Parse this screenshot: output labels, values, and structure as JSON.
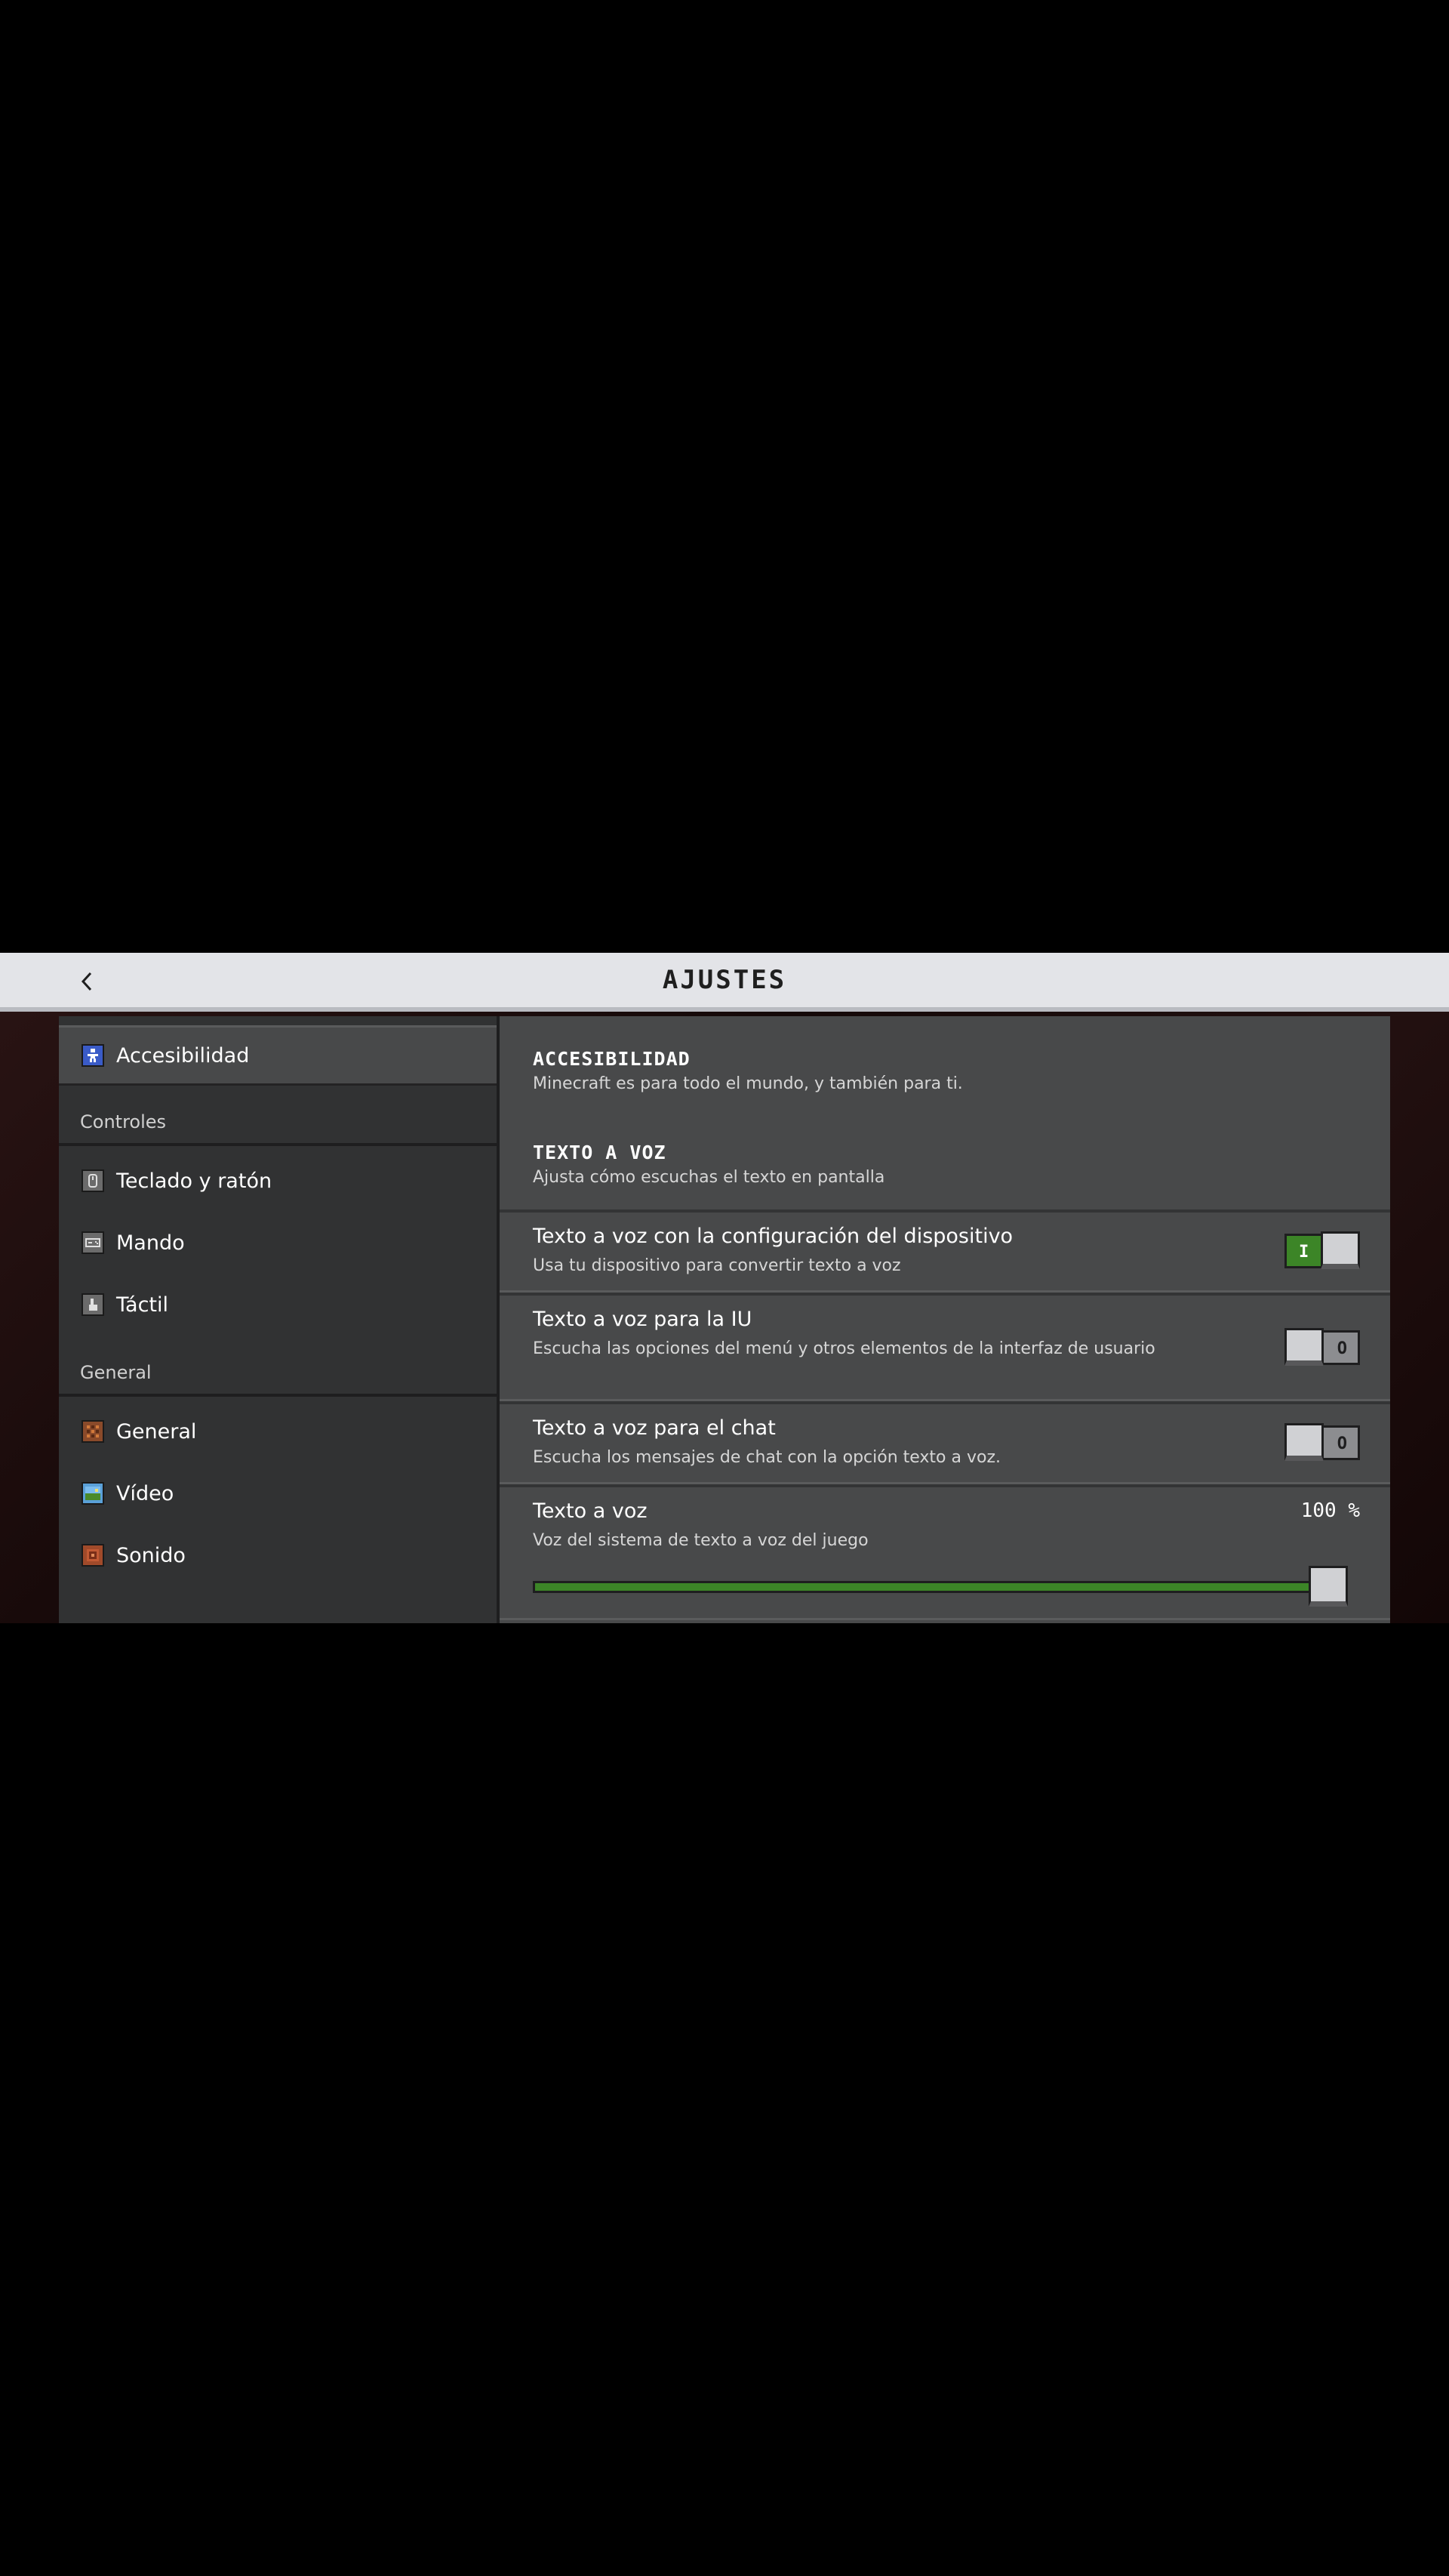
{
  "header": {
    "title": "AJUSTES"
  },
  "sidebar": {
    "active": {
      "label": "Accesibilidad",
      "icon": "accessibility-icon"
    },
    "sections": [
      {
        "label": "Controles",
        "items": [
          {
            "label": "Teclado y ratón",
            "icon": "keyboard-mouse-icon"
          },
          {
            "label": "Mando",
            "icon": "controller-icon"
          },
          {
            "label": "Táctil",
            "icon": "touch-icon"
          }
        ]
      },
      {
        "label": "General",
        "items": [
          {
            "label": "General",
            "icon": "general-icon"
          },
          {
            "label": "Vídeo",
            "icon": "video-icon"
          },
          {
            "label": "Sonido",
            "icon": "sound-icon"
          }
        ]
      }
    ]
  },
  "main": {
    "accessibility": {
      "title": "ACCESIBILIDAD",
      "subtitle": "Minecraft es para todo el mundo, y también para ti."
    },
    "tts": {
      "title": "TEXTO A VOZ",
      "subtitle": "Ajusta cómo escuchas el texto en pantalla"
    },
    "settings": [
      {
        "title": "Texto a voz con la configuración del dispositivo",
        "desc": "Usa tu dispositivo para convertir texto a voz",
        "on": true
      },
      {
        "title": "Texto a voz para la IU",
        "desc": "Escucha las opciones del menú y otros elementos de la interfaz de usuario",
        "on": false
      },
      {
        "title": "Texto a voz para el chat",
        "desc": "Escucha los mensajes de chat con la opción texto a voz.",
        "on": false
      }
    ],
    "volume": {
      "title": "Texto a voz",
      "desc": "Voz del sistema de texto a voz del juego",
      "value_label": "100 %",
      "value": 100
    }
  },
  "colors": {
    "accent_green": "#3c8527",
    "header_bg": "#e3e4e8",
    "panel_bg": "#48494a",
    "sidebar_bg": "#313233"
  }
}
